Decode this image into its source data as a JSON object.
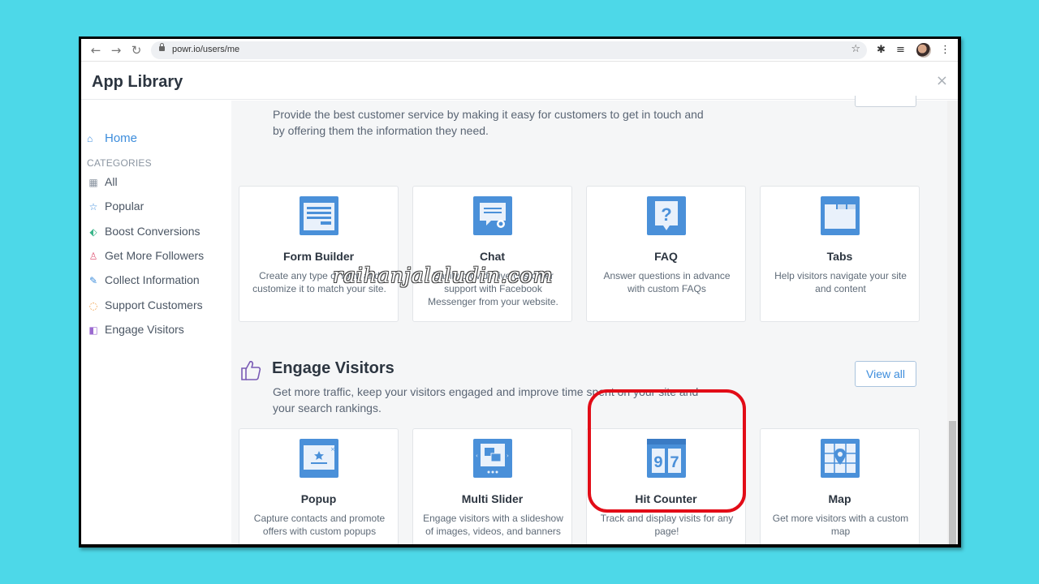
{
  "browser": {
    "url": "powr.io/users/me"
  },
  "header": {
    "title": "App Library",
    "close": "×"
  },
  "sidebar": {
    "home": "Home",
    "categories_label": "CATEGORIES",
    "items": [
      {
        "label": "All",
        "icon": "grid-icon",
        "color": "#8b95a1"
      },
      {
        "label": "Popular",
        "icon": "star-icon",
        "color": "#3d8ddc"
      },
      {
        "label": "Boost Conversions",
        "icon": "tag-icon",
        "color": "#3bb58a"
      },
      {
        "label": "Get More Followers",
        "icon": "person-icon",
        "color": "#e05c7a"
      },
      {
        "label": "Collect Information",
        "icon": "edit-icon",
        "color": "#3d8ddc"
      },
      {
        "label": "Support Customers",
        "icon": "chat-bubble-icon",
        "color": "#f09a3e"
      },
      {
        "label": "Engage Visitors",
        "icon": "thumbs-up-icon",
        "color": "#9b6ad0"
      }
    ]
  },
  "support_section": {
    "description_line1": "Provide the best customer service by making it easy for customers to get in touch and",
    "description_line2": "by offering them the information they need.",
    "cards": [
      {
        "title": "Form Builder",
        "description": "Create any type of form and customize it to match your site.",
        "icon": "form-icon"
      },
      {
        "title": "Chat",
        "description": "Easily provide live customer support with Facebook Messenger from your website.",
        "icon": "chat-icon"
      },
      {
        "title": "FAQ",
        "description": "Answer questions in advance with custom FAQs",
        "icon": "question-icon"
      },
      {
        "title": "Tabs",
        "description": "Help visitors navigate your site and content",
        "icon": "folder-tabs-icon"
      }
    ]
  },
  "engage_section": {
    "title": "Engage Visitors",
    "view_all": "View all",
    "description_line1": "Get more traffic, keep your visitors engaged and improve time spent on your site and",
    "description_line2": "your search rankings.",
    "cards": [
      {
        "title": "Popup",
        "description": "Capture contacts and promote offers with custom popups",
        "icon": "popup-icon"
      },
      {
        "title": "Multi Slider",
        "description": "Engage visitors with a slideshow of images, videos, and banners",
        "icon": "slider-icon"
      },
      {
        "title": "Hit Counter",
        "description": "Track and display visits for any page!",
        "icon": "counter-icon"
      },
      {
        "title": "Map",
        "description": "Get more visitors with a custom map",
        "icon": "map-pin-icon"
      }
    ]
  },
  "watermark": "raihanjalaludin.com",
  "colors": {
    "accent": "#3d8ddc",
    "highlight": "#e20c17",
    "icon_blue": "#4a90d9"
  }
}
